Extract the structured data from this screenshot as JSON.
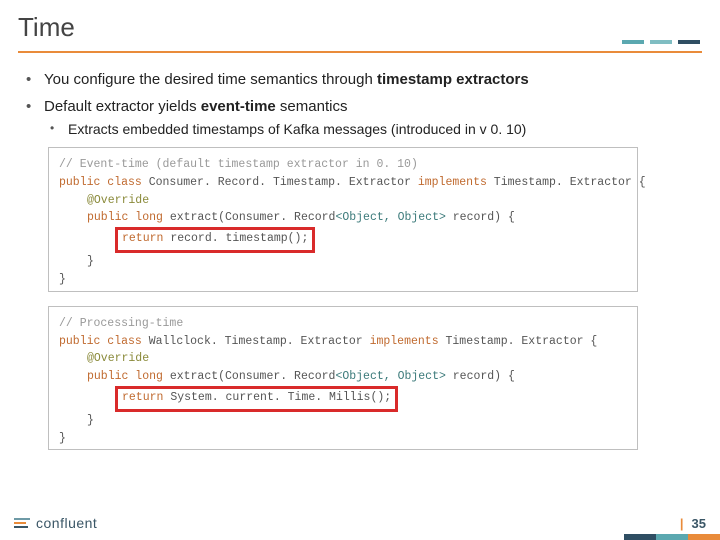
{
  "title": "Time",
  "bullets": {
    "b1_pre": "You configure the desired time semantics through ",
    "b1_bold": "timestamp extractors",
    "b2_pre": "Default extractor yields ",
    "b2_bold": "event-time",
    "b2_post": " semantics",
    "sub1": "Extracts embedded timestamps of Kafka messages (introduced in v 0. 10)"
  },
  "code1": {
    "c0": "// Event-time (default timestamp extractor in 0. 10)",
    "c1a": "public class",
    "c1b": " Consumer. Record. Timestamp. Extractor ",
    "c1c": "implements",
    "c1d": " Timestamp. Extractor {",
    "c2": "@Override",
    "c3a": "public long",
    "c3b": " extract(Consumer. Record",
    "c3c": "<Object, Object>",
    "c3d": " record) {",
    "c4a": "return",
    "c4b": " record. timestamp();",
    "c5": "}",
    "c6": "}"
  },
  "code2": {
    "c0": "// Processing-time",
    "c1a": "public class",
    "c1b": " Wallclock. Timestamp. Extractor ",
    "c1c": "implements",
    "c1d": " Timestamp. Extractor {",
    "c2": "@Override",
    "c3a": "public long",
    "c3b": " extract(Consumer. Record",
    "c3c": "<Object, Object>",
    "c3d": " record) {",
    "c4a": "return",
    "c4b": " System. current. Time. Millis();",
    "c5": "}",
    "c6": "}"
  },
  "footer": {
    "brand": "confluent",
    "page": "35"
  }
}
